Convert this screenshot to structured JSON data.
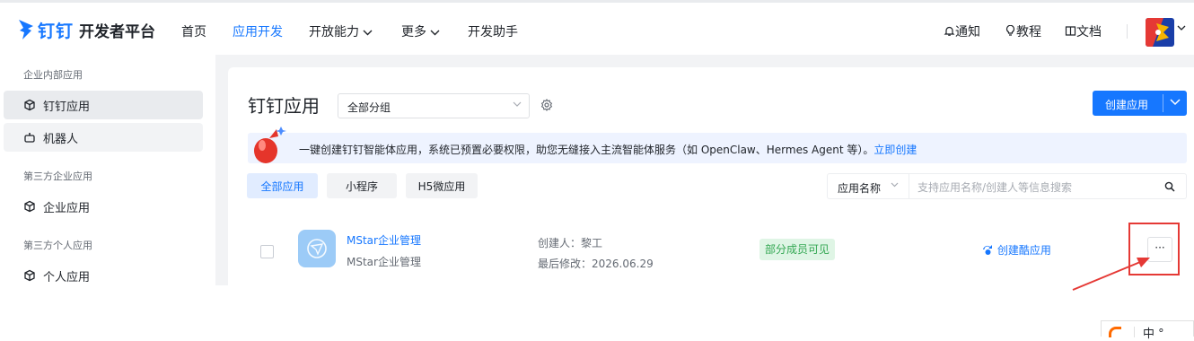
{
  "header": {
    "logo_brand": "钉钉",
    "logo_sub": "开发者平台",
    "nav": [
      {
        "label": "首页",
        "active": false
      },
      {
        "label": "应用开发",
        "active": true
      },
      {
        "label": "开放能力",
        "active": false,
        "dropdown": true
      },
      {
        "label": "更多",
        "active": false,
        "dropdown": true
      },
      {
        "label": "开发助手",
        "active": false
      }
    ],
    "notify": "通知",
    "tutorial": "教程",
    "docs": "文档"
  },
  "sidebar": {
    "groups": [
      {
        "title": "企业内部应用",
        "items": [
          {
            "label": "钉钉应用",
            "icon": "cube-icon",
            "selected": true
          },
          {
            "label": "机器人",
            "icon": "robot-icon",
            "selected": false
          }
        ]
      },
      {
        "title": "第三方企业应用",
        "items": [
          {
            "label": "企业应用",
            "icon": "cube-icon",
            "selected": false
          }
        ]
      },
      {
        "title": "第三方个人应用",
        "items": [
          {
            "label": "个人应用",
            "icon": "cube-icon",
            "selected": false
          }
        ]
      }
    ]
  },
  "main": {
    "title": "钉钉应用",
    "group_select": "全部分组",
    "create_button": "创建应用",
    "banner": {
      "text": "一键创建钉钉智能体应用，系统已预置必要权限，助您无缝接入主流智能体服务（如 OpenClaw、Hermes Agent 等）。",
      "link": "立即创建"
    },
    "tabs": [
      {
        "label": "全部应用",
        "active": true
      },
      {
        "label": "小程序",
        "active": false
      },
      {
        "label": "H5微应用",
        "active": false
      }
    ],
    "search": {
      "field": "应用名称",
      "placeholder": "支持应用名称/创建人等信息搜索"
    },
    "apps": [
      {
        "name": "MStar企业管理",
        "subtitle": "MStar企业管理",
        "creator": "创建人：黎工",
        "modified": "最后修改：2026.06.29",
        "status": "部分成员可见",
        "action": "创建酷应用",
        "more": "···"
      }
    ]
  },
  "ime": {
    "text": "中 °"
  },
  "colors": {
    "accent": "#1677ff",
    "status_green": "#34a853",
    "highlight_red": "#e53935"
  }
}
